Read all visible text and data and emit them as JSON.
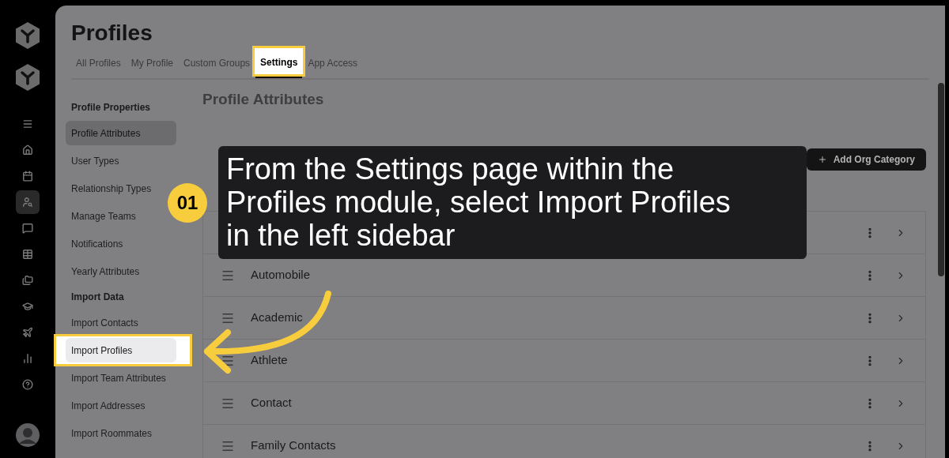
{
  "rail": {
    "items": [
      {
        "selected": false
      },
      {
        "selected": false
      },
      {
        "selected": false
      },
      {
        "selected": true
      },
      {
        "selected": false
      },
      {
        "selected": false
      },
      {
        "selected": false
      },
      {
        "selected": false
      },
      {
        "selected": false
      },
      {
        "selected": false
      },
      {
        "selected": false
      }
    ]
  },
  "page": {
    "title": "Profiles"
  },
  "tabs": [
    {
      "label": "All Profiles",
      "selected": false,
      "highlighted": false
    },
    {
      "label": "My Profile",
      "selected": false,
      "highlighted": false
    },
    {
      "label": "Custom Groups",
      "selected": false,
      "highlighted": false
    },
    {
      "label": "Settings",
      "selected": true,
      "highlighted": true
    },
    {
      "label": "App Access",
      "selected": false,
      "highlighted": false
    }
  ],
  "sidebar": {
    "items": [
      {
        "kind": "heading",
        "label": "Profile Properties"
      },
      {
        "kind": "item",
        "label": "Profile Attributes",
        "selected": true,
        "highlighted": false
      },
      {
        "kind": "item",
        "label": "User Types",
        "selected": false,
        "highlighted": false
      },
      {
        "kind": "item",
        "label": "Relationship Types",
        "selected": false,
        "highlighted": false
      },
      {
        "kind": "item",
        "label": "Manage Teams",
        "selected": false,
        "highlighted": false
      },
      {
        "kind": "item",
        "label": "Notifications",
        "selected": false,
        "highlighted": false
      },
      {
        "kind": "item",
        "label": "Yearly Attributes",
        "selected": false,
        "highlighted": false
      },
      {
        "kind": "heading",
        "label": "Import Data"
      },
      {
        "kind": "item",
        "label": "Import Contacts",
        "selected": false,
        "highlighted": false
      },
      {
        "kind": "item",
        "label": "Import Profiles",
        "selected": false,
        "highlighted": true
      },
      {
        "kind": "item",
        "label": "Import Team Attributes",
        "selected": false,
        "highlighted": false
      },
      {
        "kind": "item",
        "label": "Import Addresses",
        "selected": false,
        "highlighted": false
      },
      {
        "kind": "item",
        "label": "Import Roommates",
        "selected": false,
        "highlighted": false
      }
    ]
  },
  "content": {
    "title": "Profile Attributes",
    "add_button": "Add Org Category",
    "rows": [
      {},
      {
        "name": "Automobile"
      },
      {
        "name": "Academic"
      },
      {
        "name": "Athlete"
      },
      {
        "name": "Contact"
      },
      {
        "name": "Family Contacts"
      }
    ]
  },
  "callout": {
    "step": "01",
    "text": "From the Settings page within the Profiles module, select Import Profiles in the left sidebar"
  }
}
